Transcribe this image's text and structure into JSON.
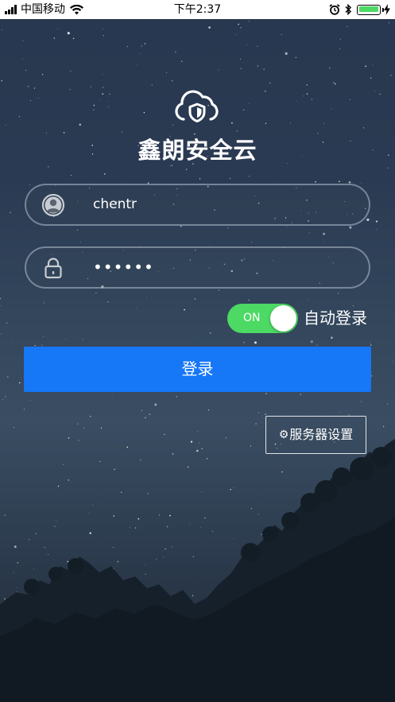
{
  "status_bar": {
    "carrier": "中国移动",
    "time": "下午2:37",
    "signal_bars": 4,
    "battery_level": 1.0,
    "icons": [
      "signal-icon",
      "wifi-icon",
      "alarm-icon",
      "bluetooth-icon",
      "battery-icon",
      "charging-icon"
    ]
  },
  "app": {
    "title": "鑫朗安全云",
    "logo_icon": "cloud-shield-icon"
  },
  "login_form": {
    "username": {
      "value": "chentr",
      "icon": "user-icon"
    },
    "password": {
      "value": "••••••",
      "icon": "lock-icon"
    },
    "auto_login": {
      "toggle_label": "ON",
      "label": "自动登录",
      "enabled": true
    },
    "login_button": "登录"
  },
  "server_settings": {
    "label": "服务器设置",
    "icon": "gear-icon"
  },
  "colors": {
    "primary_button": "#1677f7",
    "toggle_on": "#4cd964",
    "battery": "#4cd964"
  }
}
